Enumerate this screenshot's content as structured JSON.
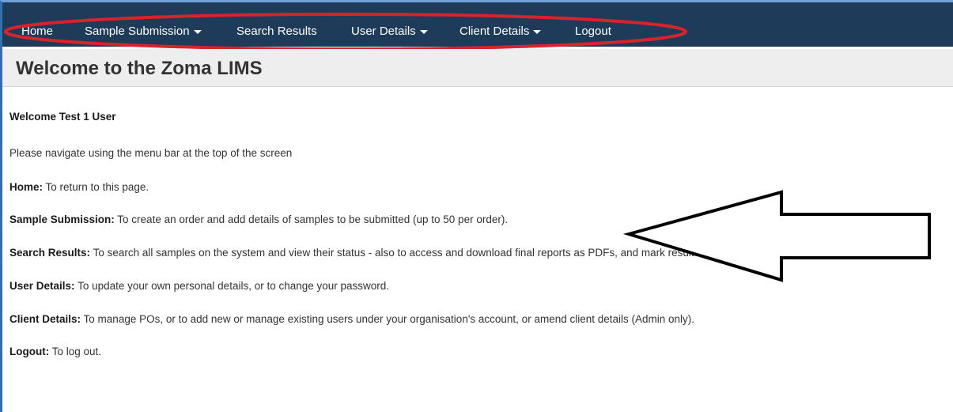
{
  "nav": {
    "home": "Home",
    "sample_submission": "Sample Submission",
    "search_results": "Search Results",
    "user_details": "User Details",
    "client_details": "Client Details",
    "logout": "Logout"
  },
  "page_title": "Welcome to the Zoma LIMS",
  "content": {
    "welcome": "Welcome Test 1 User",
    "instruction": "Please navigate using the menu bar at the top of the screen",
    "items": [
      {
        "label": "Home:",
        "text": "To return to this page."
      },
      {
        "label": "Sample Submission:",
        "text": "To create an order and add details of samples to be submitted (up to 50 per order)."
      },
      {
        "label": "Search Results:",
        "text": "To search all samples on the system and view their status - also to access and download final reports as PDFs, and mark results as Viewed."
      },
      {
        "label": "User Details:",
        "text": "To update your own personal details, or to change your password."
      },
      {
        "label": "Client Details:",
        "text": "To manage POs, or to add new or manage existing users under your organisation's account, or amend client details (Admin only)."
      },
      {
        "label": "Logout:",
        "text": "To log out."
      }
    ]
  },
  "annotation_colors": {
    "ellipse": "#d8232a",
    "arrow_stroke": "#000000",
    "arrow_fill": "#ffffff"
  }
}
